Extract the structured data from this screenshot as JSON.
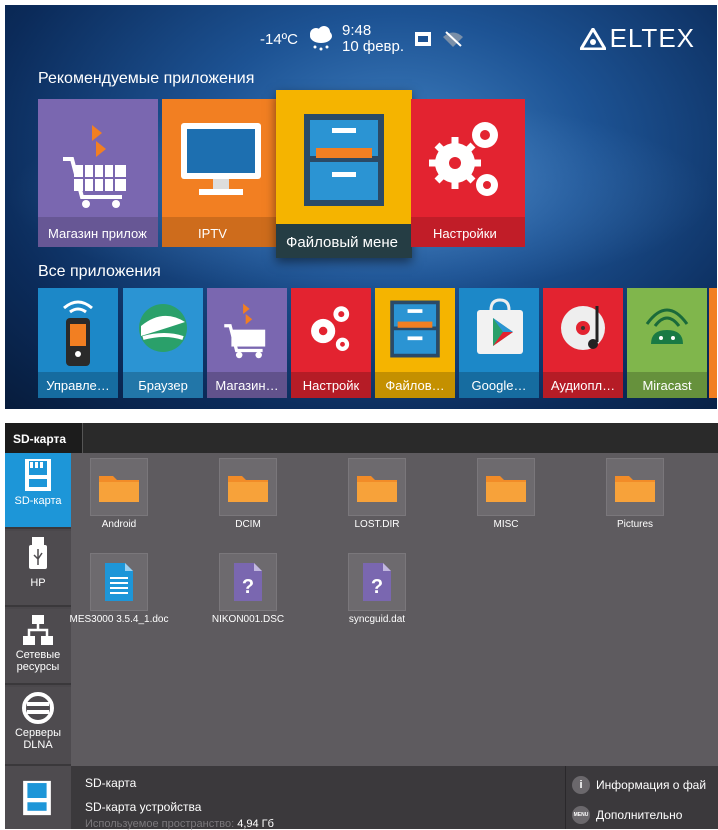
{
  "launcher": {
    "temperature": "-14ºC",
    "time": "9:48",
    "date": "10 февр.",
    "brand": "ELTEX",
    "recommended_title": "Рекомендуемые приложения",
    "all_apps_title": "Все приложения",
    "recommended": [
      {
        "label": "Магазин прилож",
        "icon": "shopping-cart-icon",
        "color": "#7a67b0"
      },
      {
        "label": "IPTV",
        "icon": "tv-monitor-icon",
        "color": "#f27f22"
      },
      {
        "label": "Файловый мене",
        "icon": "file-cabinet-icon",
        "color": "#f5b400"
      },
      {
        "label": "Настройки",
        "icon": "gears-icon",
        "color": "#e32330"
      }
    ],
    "apps": [
      {
        "label": "Управле…",
        "icon": "remote-control-icon",
        "color": "#1c88c8"
      },
      {
        "label": "Браузер",
        "icon": "browser-globe-icon",
        "color": "#2b94d3"
      },
      {
        "label": "Магазин…",
        "icon": "shopping-cart-icon",
        "color": "#7a67b0"
      },
      {
        "label": "Настройк",
        "icon": "gears-icon",
        "color": "#e32330"
      },
      {
        "label": "Файлов…",
        "icon": "file-cabinet-icon",
        "color": "#f5b400"
      },
      {
        "label": "Google…",
        "icon": "google-play-icon",
        "color": "#1c88c8"
      },
      {
        "label": "Аудиопл…",
        "icon": "audio-player-icon",
        "color": "#e32330"
      },
      {
        "label": "Miracast",
        "icon": "android-icon",
        "color": "#80b64c"
      }
    ]
  },
  "filemanager": {
    "tab": "SD-карта",
    "sidebar": [
      {
        "label": "SD-карта",
        "icon": "sd-card-icon",
        "active": true
      },
      {
        "label": "HP",
        "icon": "usb-icon",
        "active": false
      },
      {
        "label": "Сетевые ресурсы",
        "icon": "network-icon",
        "active": false
      },
      {
        "label": "Серверы DLNA",
        "icon": "dlna-icon",
        "active": false
      }
    ],
    "files": [
      {
        "name": "Android",
        "type": "folder"
      },
      {
        "name": "DCIM",
        "type": "folder"
      },
      {
        "name": "LOST.DIR",
        "type": "folder"
      },
      {
        "name": "MISC",
        "type": "folder"
      },
      {
        "name": "Pictures",
        "type": "folder"
      },
      {
        "name": "MES3000 3.5.4_1.doc",
        "type": "document"
      },
      {
        "name": "NIKON001.DSC",
        "type": "unknown"
      },
      {
        "name": "syncguid.dat",
        "type": "unknown"
      }
    ],
    "footer": {
      "title": "SD-карта",
      "subtitle": "SD-карта устройства",
      "used_label": "Используемое пространство:",
      "used_value": "4,94 Гб",
      "info_label": "Информация о фай",
      "more_label": "Дополнительно",
      "menu_badge": "MENU",
      "info_badge": "i"
    }
  }
}
